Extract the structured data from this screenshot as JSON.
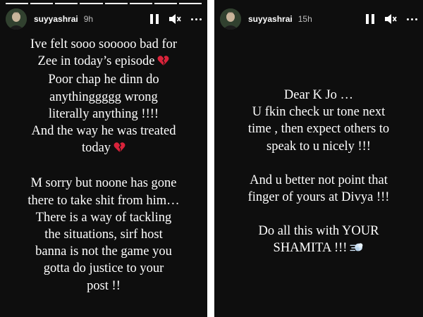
{
  "stories": [
    {
      "username": "suyyashrai",
      "time": "9h",
      "progress": {
        "total": 8,
        "current": 8
      },
      "paragraphs": [
        [
          "Ive felt sooo sooooo bad for",
          "Zee in today’s episode",
          "Poor chap he dinn do",
          "anythinggggg wrong",
          "literally anything !!!!",
          "And the way he was treated",
          "today"
        ],
        [
          "M sorry but noone has gone",
          "there to take shit from him…",
          "There is a way of tackling",
          "the situations, sirf host",
          "banna is not the game you",
          "gotta do justice to your",
          "post !!"
        ]
      ],
      "emoji_icons": [
        "broken-heart-icon",
        "broken-heart-icon"
      ]
    },
    {
      "username": "suyyashrai",
      "time": "15h",
      "paragraphs": [
        [
          "Dear K Jo …",
          "U fkin check ur tone next",
          "time , then expect others to",
          "speak to u nicely !!!"
        ],
        [
          "And u better not point that",
          "finger of yours at Divya !!!"
        ],
        [
          "Do all this with YOUR",
          "SHAMITA !!!"
        ]
      ],
      "emoji_icons": [
        "dash-icon"
      ]
    }
  ],
  "icons": {
    "pause": "pause-icon",
    "mute": "mute-icon",
    "more": "more-icon"
  },
  "colors": {
    "background": "#0e0e0e",
    "text": "#ffffff",
    "heart": "#d9233a"
  }
}
